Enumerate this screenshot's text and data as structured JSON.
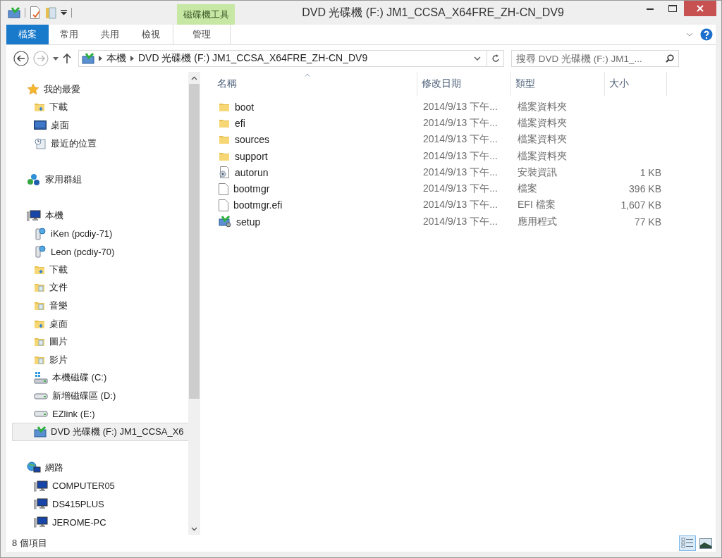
{
  "window": {
    "title": "DVD 光碟機 (F:) JM1_CCSA_X64FRE_ZH-CN_DV9"
  },
  "contextual_group": {
    "label": "磁碟機工具"
  },
  "ribbon_tabs": [
    {
      "label": "檔案",
      "kind": "file"
    },
    {
      "label": "常用",
      "kind": "normal"
    },
    {
      "label": "共用",
      "kind": "normal"
    },
    {
      "label": "檢視",
      "kind": "normal"
    },
    {
      "label": "管理",
      "kind": "contextual"
    }
  ],
  "address_bar": {
    "crumbs": [
      "本機",
      "DVD 光碟機 (F:) JM1_CCSA_X64FRE_ZH-CN_DV9"
    ]
  },
  "search": {
    "placeholder": "搜尋 DVD 光碟機 (F:) JM1_..."
  },
  "nav_pane": {
    "groups": [
      {
        "label": "我的最愛",
        "kind": "star",
        "selected": false,
        "children": [
          {
            "label": "下載",
            "kind": "download",
            "selected": false
          },
          {
            "label": "桌面",
            "kind": "desktop",
            "selected": false
          },
          {
            "label": "最近的位置",
            "kind": "recent",
            "selected": false
          }
        ]
      },
      {
        "label": "家用群組",
        "kind": "homegroup",
        "selected": false
      },
      {
        "label": "本機",
        "kind": "computer",
        "selected": false,
        "children": [
          {
            "label": "iKen (pcdiy-71)",
            "kind": "netdrive",
            "selected": false
          },
          {
            "label": "Leon (pcdiy-70)",
            "kind": "netdrive",
            "selected": false
          },
          {
            "label": "下載",
            "kind": "download",
            "selected": false
          },
          {
            "label": "文件",
            "kind": "folder",
            "selected": false
          },
          {
            "label": "音樂",
            "kind": "folder",
            "selected": false
          },
          {
            "label": "桌面",
            "kind": "download",
            "selected": false
          },
          {
            "label": "圖片",
            "kind": "folder",
            "selected": false
          },
          {
            "label": "影片",
            "kind": "folder",
            "selected": false
          },
          {
            "label": "本機磁碟 (C:)",
            "kind": "sysdrive",
            "selected": false
          },
          {
            "label": "新增磁碟區 (D:)",
            "kind": "drive",
            "selected": false
          },
          {
            "label": "EZlink (E:)",
            "kind": "drive",
            "selected": false
          },
          {
            "label": "DVD 光碟機 (F:) JM1_CCSA_X6",
            "kind": "dvd",
            "selected": true
          }
        ]
      },
      {
        "label": "網路",
        "kind": "network",
        "selected": false,
        "children": [
          {
            "label": "COMPUTER05",
            "kind": "pc",
            "selected": false
          },
          {
            "label": "DS415PLUS",
            "kind": "pc",
            "selected": false
          },
          {
            "label": "JEROME-PC",
            "kind": "pc",
            "selected": false
          }
        ]
      }
    ]
  },
  "file_list": {
    "columns": [
      "名稱",
      "修改日期",
      "類型",
      "大小"
    ],
    "rows": [
      {
        "kind": "folder",
        "name": "boot",
        "modified": "2014/9/13 下午...",
        "type": "檔案資料夾"
      },
      {
        "kind": "folder",
        "name": "efi",
        "modified": "2014/9/13 下午...",
        "type": "檔案資料夾"
      },
      {
        "kind": "folder",
        "name": "sources",
        "modified": "2014/9/13 下午...",
        "type": "檔案資料夾"
      },
      {
        "kind": "folder",
        "name": "support",
        "modified": "2014/9/13 下午...",
        "type": "檔案資料夾"
      },
      {
        "kind": "settings",
        "name": "autorun",
        "modified": "2014/9/13 下午...",
        "type": "安裝資訊",
        "size": "1 KB"
      },
      {
        "kind": "file",
        "name": "bootmgr",
        "modified": "2014/9/13 下午...",
        "type": "檔案",
        "size": "396 KB"
      },
      {
        "kind": "file",
        "name": "bootmgr.efi",
        "modified": "2014/9/13 下午...",
        "type": "EFI 檔案",
        "size": "1,607 KB"
      },
      {
        "kind": "setup",
        "name": "setup",
        "modified": "2014/9/13 下午...",
        "type": "應用程式",
        "size": "77 KB"
      }
    ]
  },
  "status_bar": {
    "text": "8 個項目"
  },
  "view_buttons": [
    {
      "kind": "details",
      "selected": true
    },
    {
      "kind": "large-icons",
      "selected": false
    }
  ]
}
